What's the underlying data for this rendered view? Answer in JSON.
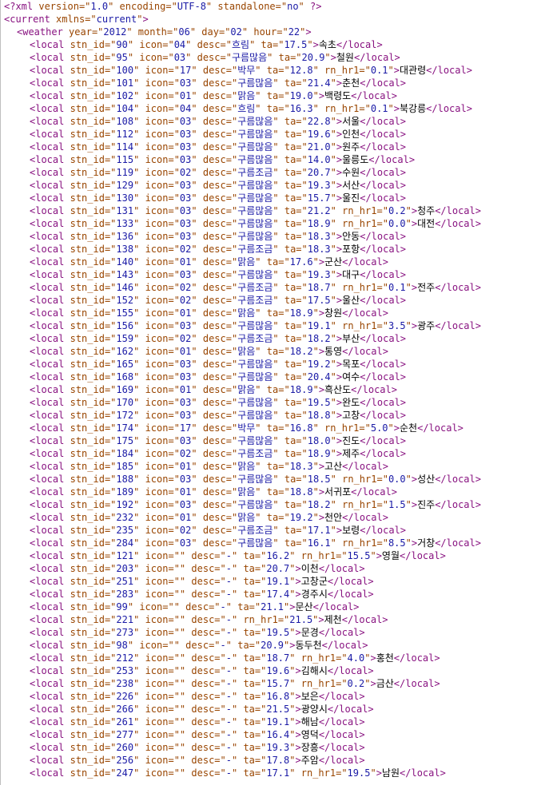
{
  "declaration": {
    "lead": "<?xml",
    "attrs": [
      {
        "name": "version",
        "value": "1.0"
      },
      {
        "name": "encoding",
        "value": "UTF-8"
      },
      {
        "name": "standalone",
        "value": "no"
      }
    ],
    "tail": "?>"
  },
  "root_open": {
    "tag": "current",
    "attrs": [
      {
        "name": "xmlns",
        "value": "current"
      }
    ]
  },
  "weather_open": {
    "tag": "weather",
    "attrs": [
      {
        "name": "year",
        "value": "2012"
      },
      {
        "name": "month",
        "value": "06"
      },
      {
        "name": "day",
        "value": "02"
      },
      {
        "name": "hour",
        "value": "22"
      }
    ]
  },
  "locals": [
    {
      "stn_id": "90",
      "icon": "04",
      "desc": "흐림",
      "ta": "17.5",
      "text": "속초"
    },
    {
      "stn_id": "95",
      "icon": "03",
      "desc": "구름많음",
      "ta": "20.9",
      "text": "철원"
    },
    {
      "stn_id": "100",
      "icon": "17",
      "desc": "박무",
      "ta": "12.8",
      "rn_hr1": "0.1",
      "text": "대관령"
    },
    {
      "stn_id": "101",
      "icon": "03",
      "desc": "구름많음",
      "ta": "21.4",
      "text": "춘천"
    },
    {
      "stn_id": "102",
      "icon": "01",
      "desc": "맑음",
      "ta": "19.0",
      "text": "백령도"
    },
    {
      "stn_id": "104",
      "icon": "04",
      "desc": "흐림",
      "ta": "16.3",
      "rn_hr1": "0.1",
      "text": "북강릉"
    },
    {
      "stn_id": "108",
      "icon": "03",
      "desc": "구름많음",
      "ta": "22.8",
      "text": "서울"
    },
    {
      "stn_id": "112",
      "icon": "03",
      "desc": "구름많음",
      "ta": "19.6",
      "text": "인천"
    },
    {
      "stn_id": "114",
      "icon": "03",
      "desc": "구름많음",
      "ta": "21.0",
      "text": "원주"
    },
    {
      "stn_id": "115",
      "icon": "03",
      "desc": "구름많음",
      "ta": "14.0",
      "text": "울릉도"
    },
    {
      "stn_id": "119",
      "icon": "02",
      "desc": "구름조금",
      "ta": "20.7",
      "text": "수원"
    },
    {
      "stn_id": "129",
      "icon": "03",
      "desc": "구름많음",
      "ta": "19.3",
      "text": "서산"
    },
    {
      "stn_id": "130",
      "icon": "03",
      "desc": "구름많음",
      "ta": "15.7",
      "text": "울진"
    },
    {
      "stn_id": "131",
      "icon": "03",
      "desc": "구름많음",
      "ta": "21.2",
      "rn_hr1": "0.2",
      "text": "청주"
    },
    {
      "stn_id": "133",
      "icon": "03",
      "desc": "구름많음",
      "ta": "18.9",
      "rn_hr1": "0.0",
      "text": "대전"
    },
    {
      "stn_id": "136",
      "icon": "03",
      "desc": "구름많음",
      "ta": "18.3",
      "text": "안동"
    },
    {
      "stn_id": "138",
      "icon": "02",
      "desc": "구름조금",
      "ta": "18.3",
      "text": "포항"
    },
    {
      "stn_id": "140",
      "icon": "01",
      "desc": "맑음",
      "ta": "17.6",
      "text": "군산"
    },
    {
      "stn_id": "143",
      "icon": "03",
      "desc": "구름많음",
      "ta": "19.3",
      "text": "대구"
    },
    {
      "stn_id": "146",
      "icon": "02",
      "desc": "구름조금",
      "ta": "18.7",
      "rn_hr1": "0.1",
      "text": "전주"
    },
    {
      "stn_id": "152",
      "icon": "02",
      "desc": "구름조금",
      "ta": "17.5",
      "text": "울산"
    },
    {
      "stn_id": "155",
      "icon": "01",
      "desc": "맑음",
      "ta": "18.9",
      "text": "창원"
    },
    {
      "stn_id": "156",
      "icon": "03",
      "desc": "구름많음",
      "ta": "19.1",
      "rn_hr1": "3.5",
      "text": "광주"
    },
    {
      "stn_id": "159",
      "icon": "02",
      "desc": "구름조금",
      "ta": "18.2",
      "text": "부산"
    },
    {
      "stn_id": "162",
      "icon": "01",
      "desc": "맑음",
      "ta": "18.2",
      "text": "통영"
    },
    {
      "stn_id": "165",
      "icon": "03",
      "desc": "구름많음",
      "ta": "19.2",
      "text": "목포"
    },
    {
      "stn_id": "168",
      "icon": "03",
      "desc": "구름많음",
      "ta": "20.4",
      "text": "여수"
    },
    {
      "stn_id": "169",
      "icon": "01",
      "desc": "맑음",
      "ta": "18.9",
      "text": "흑산도"
    },
    {
      "stn_id": "170",
      "icon": "03",
      "desc": "구름많음",
      "ta": "19.5",
      "text": "완도"
    },
    {
      "stn_id": "172",
      "icon": "03",
      "desc": "구름많음",
      "ta": "18.8",
      "text": "고창"
    },
    {
      "stn_id": "174",
      "icon": "17",
      "desc": "박무",
      "ta": "16.8",
      "rn_hr1": "5.0",
      "text": "순천"
    },
    {
      "stn_id": "175",
      "icon": "03",
      "desc": "구름많음",
      "ta": "18.0",
      "text": "진도"
    },
    {
      "stn_id": "184",
      "icon": "02",
      "desc": "구름조금",
      "ta": "18.9",
      "text": "제주"
    },
    {
      "stn_id": "185",
      "icon": "01",
      "desc": "맑음",
      "ta": "18.3",
      "text": "고산"
    },
    {
      "stn_id": "188",
      "icon": "03",
      "desc": "구름많음",
      "ta": "18.5",
      "rn_hr1": "0.0",
      "text": "성산"
    },
    {
      "stn_id": "189",
      "icon": "01",
      "desc": "맑음",
      "ta": "18.8",
      "text": "서귀포"
    },
    {
      "stn_id": "192",
      "icon": "03",
      "desc": "구름많음",
      "ta": "18.2",
      "rn_hr1": "1.5",
      "text": "진주"
    },
    {
      "stn_id": "232",
      "icon": "01",
      "desc": "맑음",
      "ta": "19.2",
      "text": "천안"
    },
    {
      "stn_id": "235",
      "icon": "02",
      "desc": "구름조금",
      "ta": "17.1",
      "text": "보령"
    },
    {
      "stn_id": "284",
      "icon": "03",
      "desc": "구름많음",
      "ta": "16.1",
      "rn_hr1": "8.5",
      "text": "거창"
    },
    {
      "stn_id": "121",
      "icon": "",
      "desc": "-",
      "ta": "16.2",
      "rn_hr1": "15.5",
      "text": "영월"
    },
    {
      "stn_id": "203",
      "icon": "",
      "desc": "-",
      "ta": "20.7",
      "text": "이천"
    },
    {
      "stn_id": "251",
      "icon": "",
      "desc": "-",
      "ta": "19.1",
      "text": "고창군"
    },
    {
      "stn_id": "283",
      "icon": "",
      "desc": "-",
      "ta": "17.4",
      "text": "경주시"
    },
    {
      "stn_id": "99",
      "icon": "",
      "desc": "-",
      "ta": "21.1",
      "text": "문산"
    },
    {
      "stn_id": "221",
      "icon": "",
      "desc": "-",
      "rn_hr1": "21.5",
      "text": "제천"
    },
    {
      "stn_id": "273",
      "icon": "",
      "desc": "-",
      "ta": "19.5",
      "text": "문경"
    },
    {
      "stn_id": "98",
      "icon": "",
      "desc": "-",
      "ta": "20.9",
      "text": "동두천"
    },
    {
      "stn_id": "212",
      "icon": "",
      "desc": "-",
      "ta": "18.7",
      "rn_hr1": "4.0",
      "text": "홍천"
    },
    {
      "stn_id": "253",
      "icon": "",
      "desc": "-",
      "ta": "19.6",
      "text": "김해시"
    },
    {
      "stn_id": "238",
      "icon": "",
      "desc": "-",
      "ta": "15.7",
      "rn_hr1": "0.2",
      "text": "금산"
    },
    {
      "stn_id": "226",
      "icon": "",
      "desc": "-",
      "ta": "16.8",
      "text": "보은"
    },
    {
      "stn_id": "266",
      "icon": "",
      "desc": "-",
      "ta": "21.5",
      "text": "광양시"
    },
    {
      "stn_id": "261",
      "icon": "",
      "desc": "-",
      "ta": "19.1",
      "text": "해남"
    },
    {
      "stn_id": "277",
      "icon": "",
      "desc": "-",
      "ta": "16.4",
      "text": "영덕"
    },
    {
      "stn_id": "260",
      "icon": "",
      "desc": "-",
      "ta": "19.3",
      "text": "장흥"
    },
    {
      "stn_id": "256",
      "icon": "",
      "desc": "-",
      "ta": "17.8",
      "text": "주암"
    },
    {
      "stn_id": "247",
      "icon": "",
      "desc": "-",
      "ta": "17.1",
      "rn_hr1": "19.5",
      "text": "남원"
    }
  ],
  "colors": {
    "tag": "#881280",
    "attr_name": "#994500",
    "attr_value": "#1a1aa6",
    "text": "#000000",
    "background": "#ffffff"
  }
}
